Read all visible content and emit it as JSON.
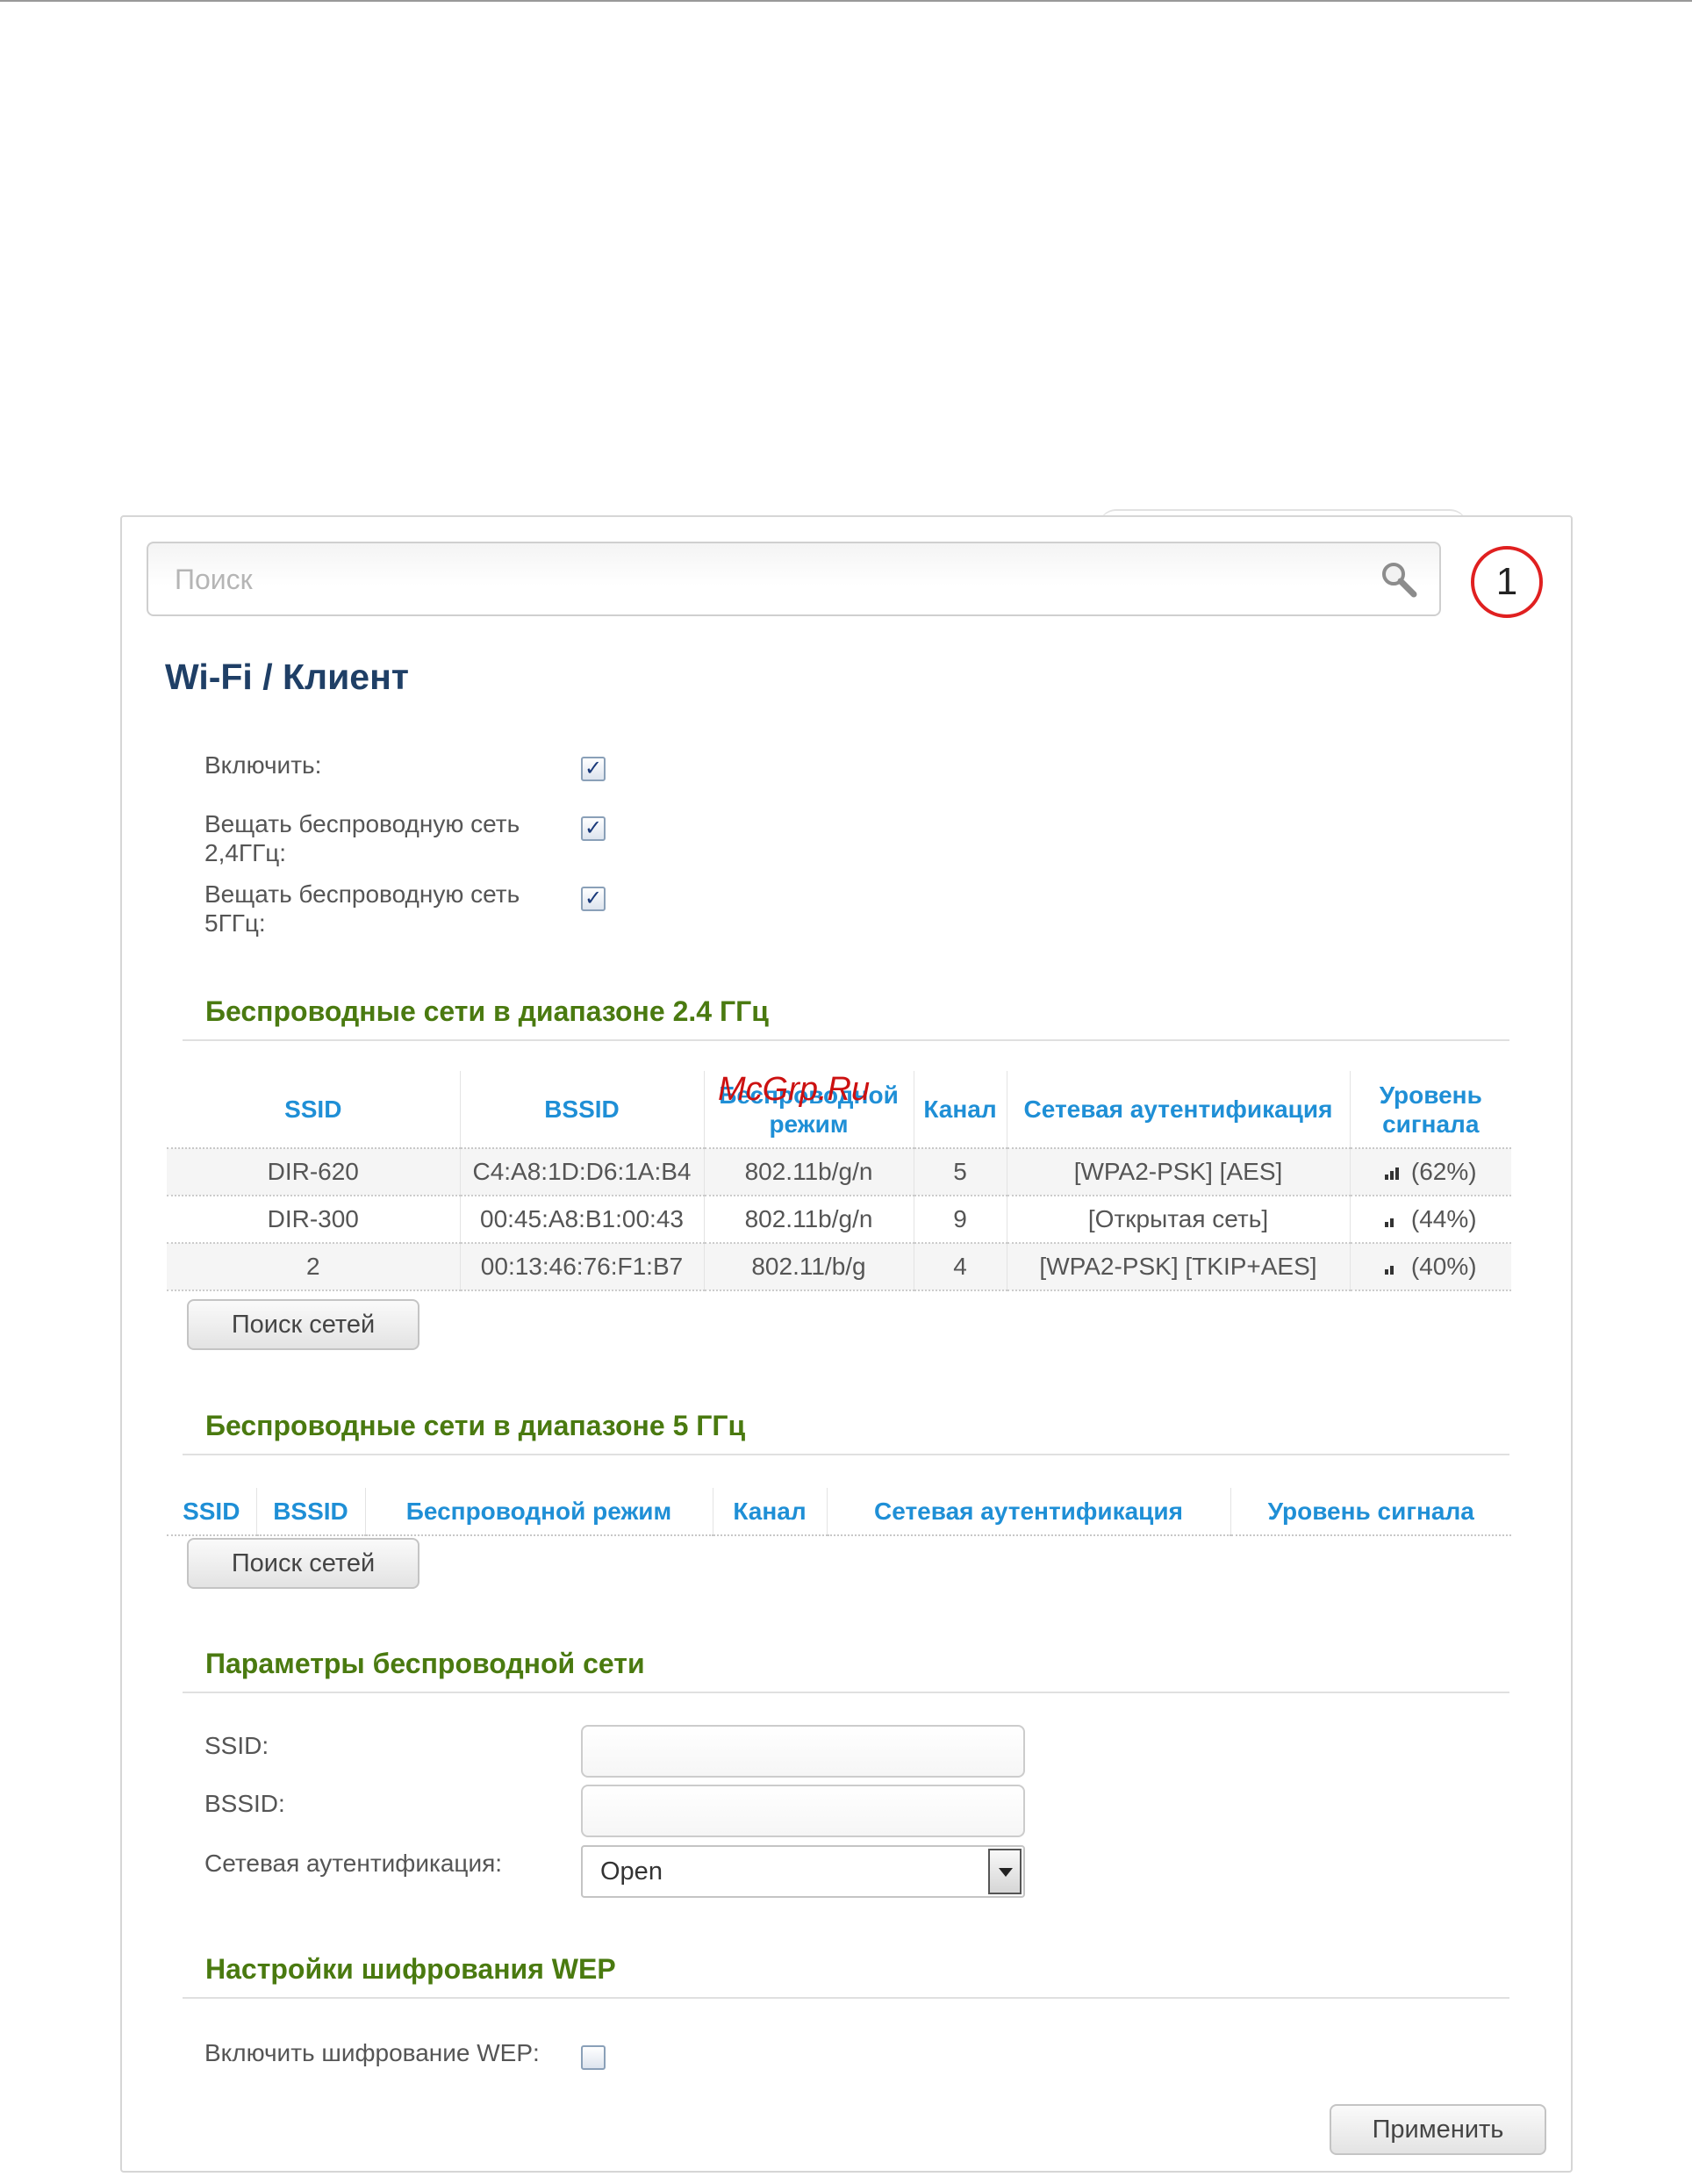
{
  "search": {
    "placeholder": "Поиск"
  },
  "marker": "1",
  "breadcrumb": {
    "section": "Wi-Fi /",
    "page": "Клиент"
  },
  "settings": {
    "enable_label": "Включить:",
    "enable_checked": true,
    "broadcast_24_label": [
      "Вещать беспроводную сеть",
      "2,4ГГц:"
    ],
    "broadcast_24_checked": true,
    "broadcast_5_label": [
      "Вещать беспроводную сеть",
      "5ГГц:"
    ],
    "broadcast_5_checked": true
  },
  "networks_24": {
    "title": "Беспроводные сети в диапазоне 2.4 ГГц",
    "columns": [
      "SSID",
      "BSSID",
      "Беспроводной режим",
      "Канал",
      "Сетевая аутентификация",
      "Уровень сигнала"
    ],
    "rows": [
      {
        "ssid": "DIR-620",
        "bssid": "C4:A8:1D:D6:1A:B4",
        "mode": "802.11b/g/n",
        "channel": "5",
        "auth": "[WPA2-PSK] [AES]",
        "signal": "(62%)",
        "signal_percent": 62
      },
      {
        "ssid": "DIR-300",
        "bssid": "00:45:A8:B1:00:43",
        "mode": "802.11b/g/n",
        "channel": "9",
        "auth": "[Открытая сеть]",
        "signal": "(44%)",
        "signal_percent": 44
      },
      {
        "ssid": "2",
        "bssid": "00:13:46:76:F1:B7",
        "mode": "802.11/b/g",
        "channel": "4",
        "auth": "[WPA2-PSK] [TKIP+AES]",
        "signal": "(40%)",
        "signal_percent": 40
      }
    ],
    "scan_button": "Поиск сетей"
  },
  "networks_5": {
    "title": "Беспроводные сети в диапазоне 5 ГГц",
    "columns": [
      "SSID",
      "BSSID",
      "Беспроводной режим",
      "Канал",
      "Сетевая аутентификация",
      "Уровень сигнала"
    ],
    "scan_button": "Поиск сетей"
  },
  "params": {
    "title": "Параметры беспроводной сети",
    "ssid_label": "SSID:",
    "ssid_value": "",
    "bssid_label": "BSSID:",
    "bssid_value": "",
    "auth_label": "Сетевая аутентификация:",
    "auth_value": "Open"
  },
  "wep": {
    "title": "Настройки шифрования WEP",
    "enable_label": "Включить шифрование WEP:",
    "enable_checked": false
  },
  "apply_button": "Применить",
  "watermark": "McGrp.Ru"
}
